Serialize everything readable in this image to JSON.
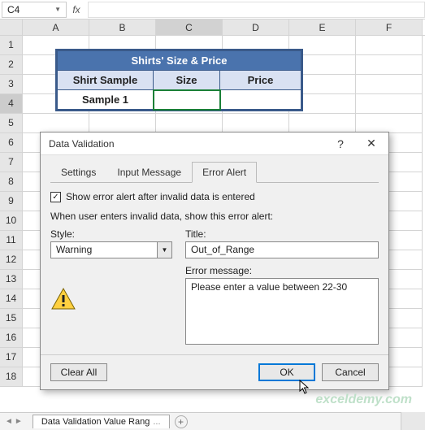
{
  "namebox": "C4",
  "fx_label": "fx",
  "columns": [
    "A",
    "B",
    "C",
    "D",
    "E",
    "F"
  ],
  "rows": [
    "1",
    "2",
    "3",
    "4",
    "5",
    "6",
    "7",
    "8",
    "9",
    "10",
    "11",
    "12",
    "13",
    "14",
    "15",
    "16",
    "17",
    "18"
  ],
  "table": {
    "title": "Shirts' Size & Price",
    "headers": [
      "Shirt Sample",
      "Size",
      "Price"
    ],
    "row1": [
      "Sample 1",
      "",
      ""
    ]
  },
  "dialog": {
    "title": "Data Validation",
    "help": "?",
    "close": "✕",
    "tabs": [
      "Settings",
      "Input Message",
      "Error Alert"
    ],
    "checkbox_label": "Show error alert after invalid data is entered",
    "sub": "When user enters invalid data, show this error alert:",
    "style_label": "Style:",
    "style_value": "Warning",
    "title_label": "Title:",
    "title_value": "Out_of_Range",
    "errmsg_label": "Error message:",
    "errmsg_value": "Please enter a value between 22-30",
    "clear": "Clear All",
    "ok": "OK",
    "cancel": "Cancel"
  },
  "watermark": "exceldemy.com",
  "sheet_tab": "Data Validation Value Rang",
  "plus": "+"
}
